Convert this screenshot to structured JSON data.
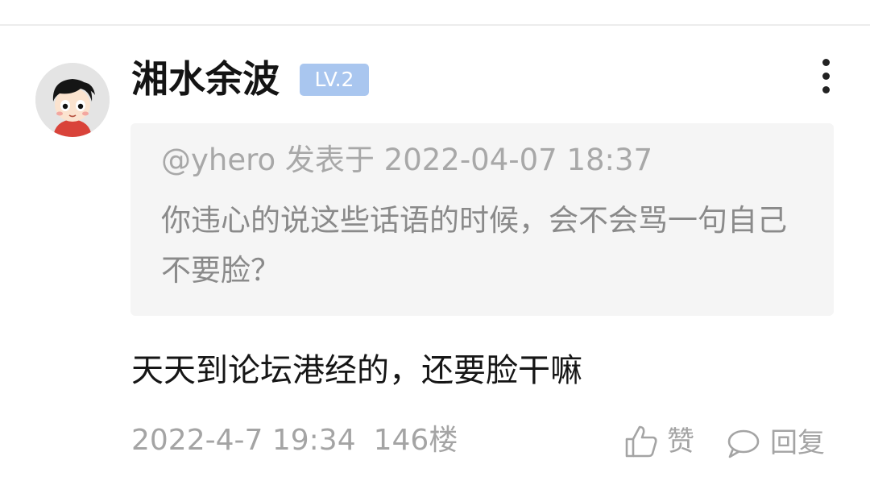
{
  "post": {
    "author": {
      "name": "湘水余波",
      "level": "LV.2",
      "avatar_icon": "cartoon-avatar-icon"
    },
    "quote": {
      "meta": "@yhero 发表于 2022-04-07 18:37",
      "text": "你违心的说这些话语的时候，会不会骂一句自己不要脸？"
    },
    "content": "天天到论坛港经的，还要脸干嘛",
    "timestamp": "2022-4-7 19:34",
    "floor": "146楼",
    "actions": {
      "like_label": "赞",
      "reply_label": "回复"
    },
    "more_icon": "more-vertical-icon"
  },
  "colors": {
    "level_badge": "#a9c6ef",
    "quote_background": "#f5f5f5",
    "muted_text": "#a4a4a4"
  }
}
